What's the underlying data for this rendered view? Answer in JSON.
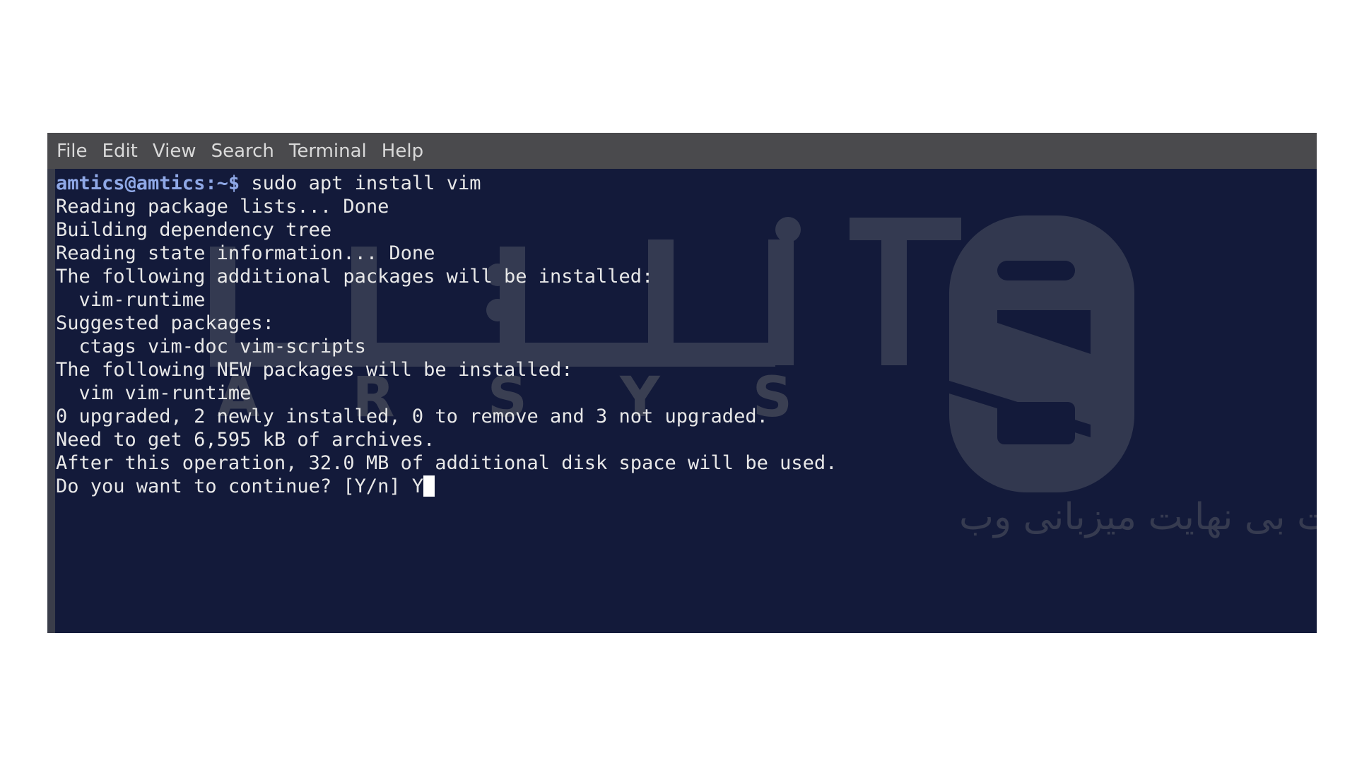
{
  "menu": {
    "file": "File",
    "edit": "Edit",
    "view": "View",
    "search": "Search",
    "terminal": "Terminal",
    "help": "Help"
  },
  "terminal": {
    "prompt": "amtics@amtics:~$",
    "command": " sudo apt install vim",
    "lines": [
      "Reading package lists... Done",
      "Building dependency tree",
      "Reading state information... Done",
      "The following additional packages will be installed:",
      "  vim-runtime",
      "Suggested packages:",
      "  ctags vim-doc vim-scripts",
      "The following NEW packages will be installed:",
      "  vim vim-runtime",
      "0 upgraded, 2 newly installed, 0 to remove and 3 not upgraded.",
      "Need to get 6,595 kB of archives.",
      "After this operation, 32.0 MB of additional disk space will be used."
    ],
    "question": "Do you want to continue? [Y/n] ",
    "answer": "Y"
  },
  "watermark": {
    "brand_latin": "A  R  S  Y  S",
    "brand_persian": "آذرسیس",
    "tagline": "سرعت بی نهایت میزبانی وب"
  },
  "colors": {
    "background": "#131a3a",
    "menubar": "#4a4a4d",
    "prompt": "#8fa8e6",
    "text": "#e8e8e8",
    "watermark": "#3a3f52"
  }
}
